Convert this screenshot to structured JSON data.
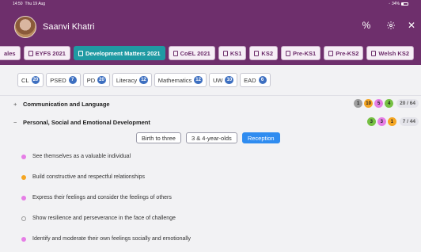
{
  "status_bar": {
    "time": "14:50",
    "date": "Thu 19 Aug",
    "battery": "34%"
  },
  "header": {
    "user_name": "Saanvi Khatri",
    "icons": [
      "percent-icon",
      "gear-icon",
      "close-icon"
    ]
  },
  "tabs": [
    {
      "label": "ales",
      "active": false
    },
    {
      "label": "EYFS 2021",
      "active": false
    },
    {
      "label": "Development Matters 2021",
      "active": true
    },
    {
      "label": "CoEL 2021",
      "active": false
    },
    {
      "label": "KS1",
      "active": false
    },
    {
      "label": "KS2",
      "active": false
    },
    {
      "label": "Pre-KS1",
      "active": false
    },
    {
      "label": "Pre-KS2",
      "active": false
    },
    {
      "label": "Welsh KS2",
      "active": false
    }
  ],
  "areas": [
    {
      "label": "CL",
      "count": "20"
    },
    {
      "label": "PSED",
      "count": "7"
    },
    {
      "label": "PD",
      "count": "20"
    },
    {
      "label": "Literacy",
      "count": "12"
    },
    {
      "label": "Mathematics",
      "count": "12"
    },
    {
      "label": "UW",
      "count": "10"
    },
    {
      "label": "EAD",
      "count": "6"
    }
  ],
  "sections": [
    {
      "sign": "+",
      "title": "Communication and Language",
      "badges": [
        {
          "value": "1",
          "color": "#9e9e9e"
        },
        {
          "value": "10",
          "color": "#f5a623"
        },
        {
          "value": "5",
          "color": "#e67ee6"
        },
        {
          "value": "4",
          "color": "#76c043"
        }
      ],
      "score": "20 / 64"
    },
    {
      "sign": "−",
      "title": "Personal, Social and Emotional Development",
      "badges": [
        {
          "value": "3",
          "color": "#76c043"
        },
        {
          "value": "3",
          "color": "#e67ee6"
        },
        {
          "value": "1",
          "color": "#f5a623"
        }
      ],
      "score": "7 / 44"
    }
  ],
  "age_bands": [
    {
      "label": "Birth to three",
      "active": false
    },
    {
      "label": "3 & 4-year-olds",
      "active": false
    },
    {
      "label": "Reception",
      "active": true
    }
  ],
  "statements": [
    {
      "text": "See themselves as a valuable individual",
      "color": "#e67ee6",
      "hollow": false
    },
    {
      "text": "Build constructive and respectful relationships",
      "color": "#f5a623",
      "hollow": false
    },
    {
      "text": "Express their feelings and consider the feelings of others",
      "color": "#e67ee6",
      "hollow": false
    },
    {
      "text": "Show resilience and perseverance in the face of challenge",
      "color": "#999999",
      "hollow": true
    },
    {
      "text": "Identify and moderate their own feelings socially and emotionally",
      "color": "#e67ee6",
      "hollow": false
    }
  ]
}
